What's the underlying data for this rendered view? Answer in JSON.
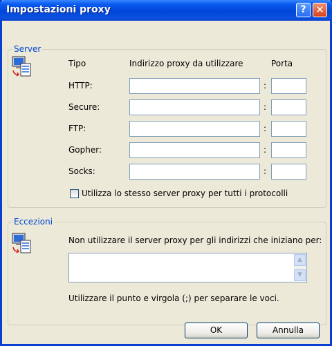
{
  "window": {
    "title": "Impostazioni proxy",
    "help_glyph": "?",
    "close_glyph": "✕"
  },
  "server": {
    "legend": "Server",
    "header": {
      "tipo": "Tipo",
      "indirizzo": "Indirizzo proxy da utilizzare",
      "porta": "Porta"
    },
    "rows": [
      {
        "label": "HTTP:",
        "address": "",
        "port": ""
      },
      {
        "label": "Secure:",
        "address": "",
        "port": ""
      },
      {
        "label": "FTP:",
        "address": "",
        "port": ""
      },
      {
        "label": "Gopher:",
        "address": "",
        "port": ""
      },
      {
        "label": "Socks:",
        "address": "",
        "port": ""
      }
    ],
    "colon": ":",
    "same_proxy_label": "Utilizza lo stesso server proxy per tutti i protocolli",
    "same_proxy_checked": false
  },
  "exceptions": {
    "legend": "Eccezioni",
    "instruction": "Non utilizzare il server proxy per gli indirizzi che iniziano per:",
    "value": "",
    "hint": "Utilizzare il punto e virgola (;) per separare le voci."
  },
  "buttons": {
    "ok": "OK",
    "cancel": "Annulla"
  },
  "icons": {
    "server": "network-computer-icon",
    "exceptions": "network-computer-icon"
  }
}
